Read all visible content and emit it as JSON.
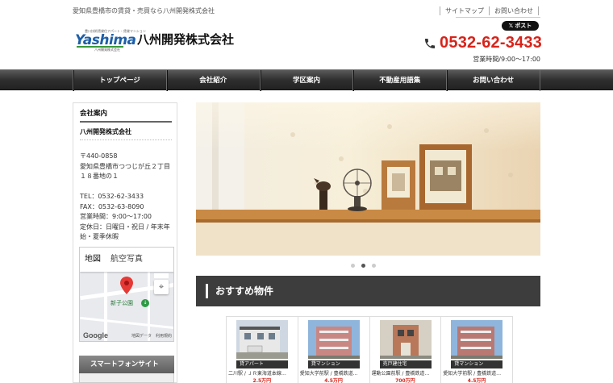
{
  "header": {
    "tagline": "愛知県豊橋市の賃貸・売買なら八州開発株式会社",
    "links": [
      "サイトマップ",
      "お問い合わせ"
    ],
    "share_label": "ポスト",
    "logo_small": "豊川技術賃貸住アパート・賃貸マンション",
    "logo_mark": "Yashima",
    "logo_sub": "八州開発株式会社",
    "company_name": "八州開発株式会社",
    "phone": "0532-62-3433",
    "hours": "営業時間/9:00～17:00"
  },
  "nav": {
    "items": [
      "トップページ",
      "会社紹介",
      "学区案内",
      "不動産用語集",
      "お問い合わせ"
    ]
  },
  "sidebar": {
    "title": "会社案内",
    "company": "八州開発株式会社",
    "lines": [
      "〒440-0858",
      "愛知県豊橋市つつじが丘２丁目",
      "１８番地の１",
      "",
      "TEL：0532-62-3433",
      "FAX：0532-63-8090",
      "営業時間：9:00～17:00",
      "定休日：日曜日・祝日 / 年末年",
      "始・夏季休暇"
    ],
    "map": {
      "tabs": [
        "地図",
        "航空写真"
      ],
      "park_label": "新子公園",
      "google_label": "Google",
      "footer": "地図データ　利用規約"
    },
    "smartphone_title": "スマートフォンサイト"
  },
  "slider": {
    "dot_count": 3,
    "active_index": 1
  },
  "recommended": {
    "title": "おすすめ物件",
    "items": [
      {
        "type": "貸アパート",
        "desc": "二川駅 / ＪＲ東海道本線…",
        "price": "2.5万円"
      },
      {
        "type": "貸マンション",
        "desc": "愛知大学前駅 / 豊橋鉄道…",
        "price": "4.5万円"
      },
      {
        "type": "売戸建住宅",
        "desc": "運動公園前駅 / 豊橋鉄道…",
        "price": "700万円"
      },
      {
        "type": "貸マンション",
        "desc": "愛知大学前駅 / 豊橋鉄道…",
        "price": "4.5万円"
      }
    ]
  }
}
